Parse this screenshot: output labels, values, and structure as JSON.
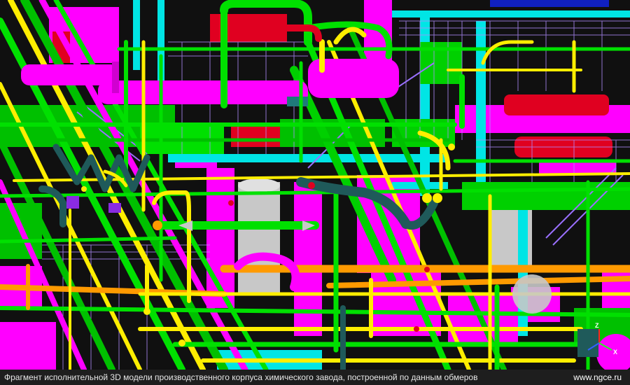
{
  "caption": {
    "text": "Фрагмент исполнительной 3D модели производственного корпуса химического завода, построенной по данным обмеров",
    "site": "www.ngce.ru"
  },
  "axes": {
    "x_label": "X",
    "z_label": "Z"
  },
  "colors": {
    "background": "#0a0a0a",
    "magenta": "#ff00ff",
    "green": "#00e000",
    "yellow": "#ffee00",
    "cyan": "#00e5e5",
    "red": "#e00020",
    "orange": "#ff9a00",
    "dark_teal": "#1f5a5a",
    "grey": "#c8c8c8"
  }
}
